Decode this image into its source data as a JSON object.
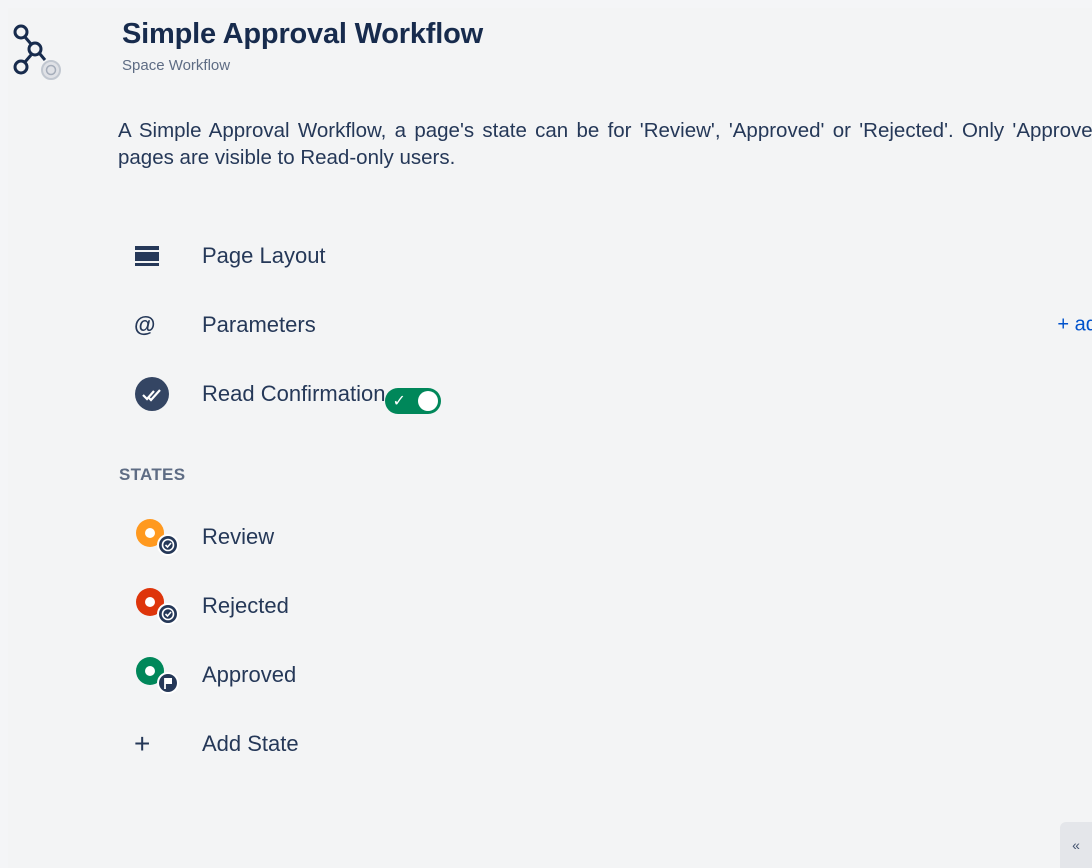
{
  "header": {
    "title": "Simple Approval Workflow",
    "subtitle": "Space Workflow",
    "icon": "workflow-icon"
  },
  "description": "A Simple Approval Workflow, a page's state can be for 'Review', 'Approved' or 'Rejected'. Only 'Approved' pages are visible to Read-only users.",
  "settings": {
    "page_layout": {
      "label": "Page Layout",
      "icon": "page-layout-icon"
    },
    "parameters": {
      "label": "Parameters",
      "icon": "at-sign-icon",
      "action": "+ add"
    },
    "read_confirmation": {
      "label": "Read Confirmation",
      "icon": "double-check-icon",
      "toggle_on": true,
      "toggle_glyph": "✓"
    }
  },
  "states": {
    "heading": "STATES",
    "items": [
      {
        "label": "Review",
        "color": "#ff991f",
        "badge": "check"
      },
      {
        "label": "Rejected",
        "color": "#de350b",
        "badge": "check"
      },
      {
        "label": "Approved",
        "color": "#00875a",
        "badge": "flag"
      }
    ],
    "add_label": "Add State",
    "add_glyph": "+"
  },
  "footer": {
    "collapse_glyph": "«"
  },
  "colors": {
    "accent": "#0052cc",
    "toggle_on": "#00875a",
    "text": "#253858"
  }
}
